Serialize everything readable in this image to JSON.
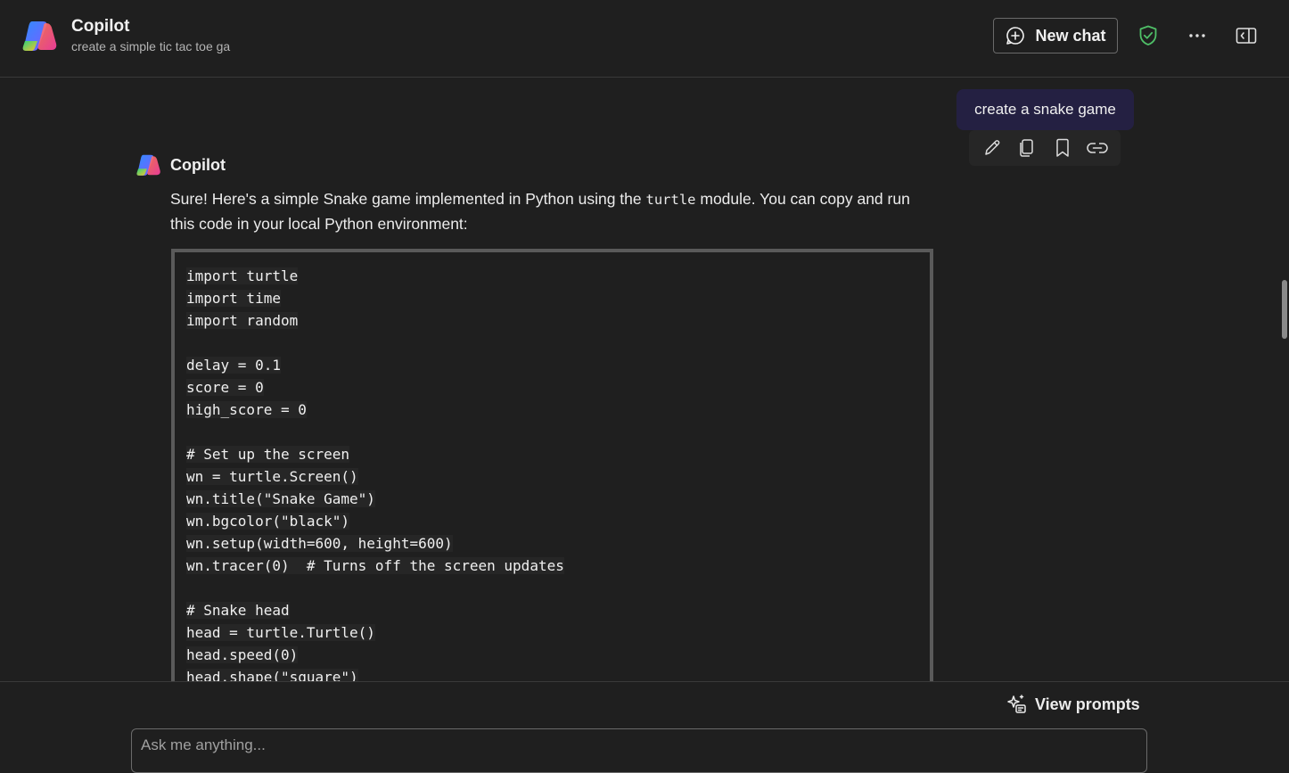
{
  "header": {
    "app_title": "Copilot",
    "conversation_title": "create a simple tic tac toe ga",
    "new_chat_label": "New chat",
    "shield_icon": "shield-check-icon",
    "more_icon": "more-horizontal-icon",
    "side_panel_icon": "side-panel-icon"
  },
  "colors": {
    "background": "#1f1f1f",
    "user_bubble": "#242042",
    "shield": "#4fbf67"
  },
  "user_message": {
    "text": "create a snake game",
    "actions": [
      "edit-icon",
      "copy-icon",
      "bookmark-icon",
      "link-icon"
    ]
  },
  "bot_message": {
    "name": "Copilot",
    "intro_before": "Sure! Here's a simple Snake game implemented in Python using the ",
    "intro_code": "turtle",
    "intro_after": " module. You can copy and run this code in your local Python environment:",
    "code_lines": [
      "import turtle",
      "import time",
      "import random",
      "",
      "delay = 0.1",
      "score = 0",
      "high_score = 0",
      "",
      "# Set up the screen",
      "wn = turtle.Screen()",
      "wn.title(\"Snake Game\")",
      "wn.bgcolor(\"black\")",
      "wn.setup(width=600, height=600)",
      "wn.tracer(0)  # Turns off the screen updates",
      "",
      "# Snake head",
      "head = turtle.Turtle()",
      "head.speed(0)",
      "head.shape(\"square\")"
    ]
  },
  "footer": {
    "view_prompts_label": "View prompts",
    "ask_placeholder": "Ask me anything..."
  }
}
